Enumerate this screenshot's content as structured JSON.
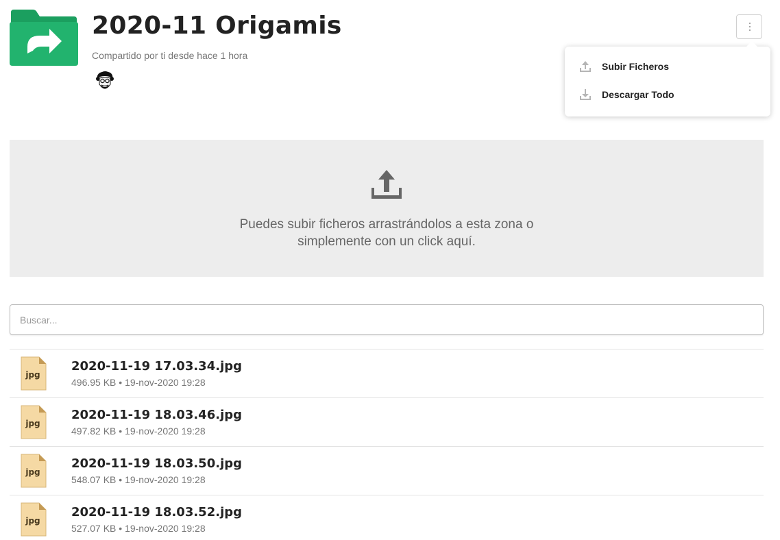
{
  "header": {
    "title": "2020-11 Origamis",
    "subtitle": "Compartido por ti desde hace 1 hora",
    "folder_icon": "shared-folder-icon",
    "folder_color": "#1fae6a"
  },
  "menu": {
    "icon": "kebab-menu-icon",
    "items": [
      {
        "label": "Subir Ficheros",
        "icon": "upload-icon"
      },
      {
        "label": "Descargar Todo",
        "icon": "download-icon"
      }
    ]
  },
  "dropzone": {
    "icon": "upload-icon",
    "text_line1": "Puedes subir ficheros arrastrándolos a esta zona o",
    "text_line2": "simplemente con un click aquí."
  },
  "search": {
    "placeholder": "Buscar...",
    "value": ""
  },
  "files": [
    {
      "name": "2020-11-19 17.03.34.jpg",
      "meta": "496.95 KB • 19-nov-2020 19:28",
      "type": "jpg"
    },
    {
      "name": "2020-11-19 18.03.46.jpg",
      "meta": "497.82 KB • 19-nov-2020 19:28",
      "type": "jpg"
    },
    {
      "name": "2020-11-19 18.03.50.jpg",
      "meta": "548.07 KB • 19-nov-2020 19:28",
      "type": "jpg"
    },
    {
      "name": "2020-11-19 18.03.52.jpg",
      "meta": "527.07 KB • 19-nov-2020 19:28",
      "type": "jpg"
    }
  ],
  "colors": {
    "folder_green": "#1fae6a",
    "file_icon_bg": "#f5d9a4",
    "dropzone_bg": "#ededed"
  }
}
